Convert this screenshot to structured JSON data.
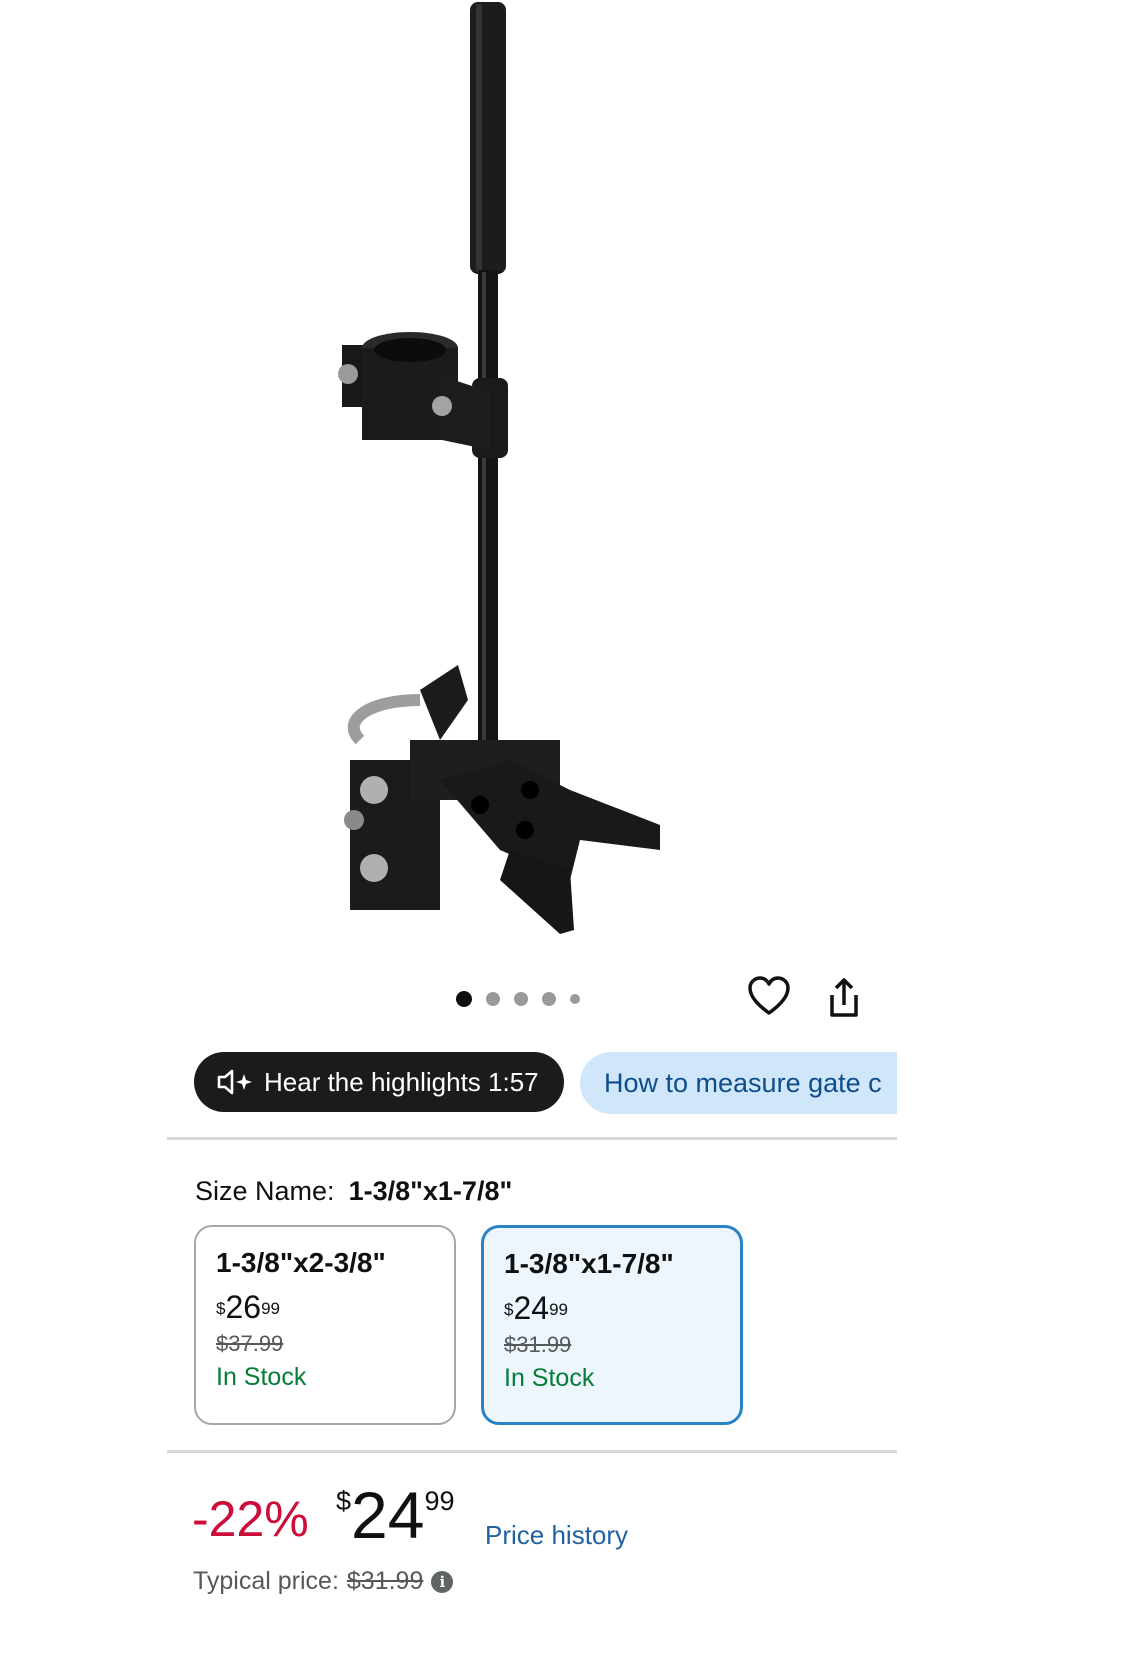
{
  "product": {
    "image_icon": "gate-drop-rod-product-image",
    "carousel": {
      "total": 5,
      "active_index": 0
    }
  },
  "actions": {
    "wishlist_icon": "heart-icon",
    "share_icon": "share-icon"
  },
  "pills": {
    "hear_label": "Hear the highlights 1:57",
    "hear_icon": "speaker-sparkle-icon",
    "measure_label": "How to measure gate c"
  },
  "size": {
    "label": "Size Name:",
    "selected_value": "1-3/8\"x1-7/8\"",
    "options": [
      {
        "title": "1-3/8\"x2-3/8\"",
        "price_symbol": "$",
        "price_whole": "26",
        "price_fraction": "99",
        "list_price": "$37.99",
        "stock": "In Stock",
        "selected": false
      },
      {
        "title": "1-3/8\"x1-7/8\"",
        "price_symbol": "$",
        "price_whole": "24",
        "price_fraction": "99",
        "list_price": "$31.99",
        "stock": "In Stock",
        "selected": true
      }
    ]
  },
  "pricing": {
    "discount": "-22%",
    "symbol": "$",
    "whole": "24",
    "fraction": "99",
    "price_history_label": "Price history",
    "typical_label": "Typical price:",
    "typical_value": "$31.99"
  },
  "colors": {
    "discount": "#cc0c39",
    "in_stock": "#067d37",
    "link": "#2162a1",
    "selected_border": "#2a83c5"
  }
}
